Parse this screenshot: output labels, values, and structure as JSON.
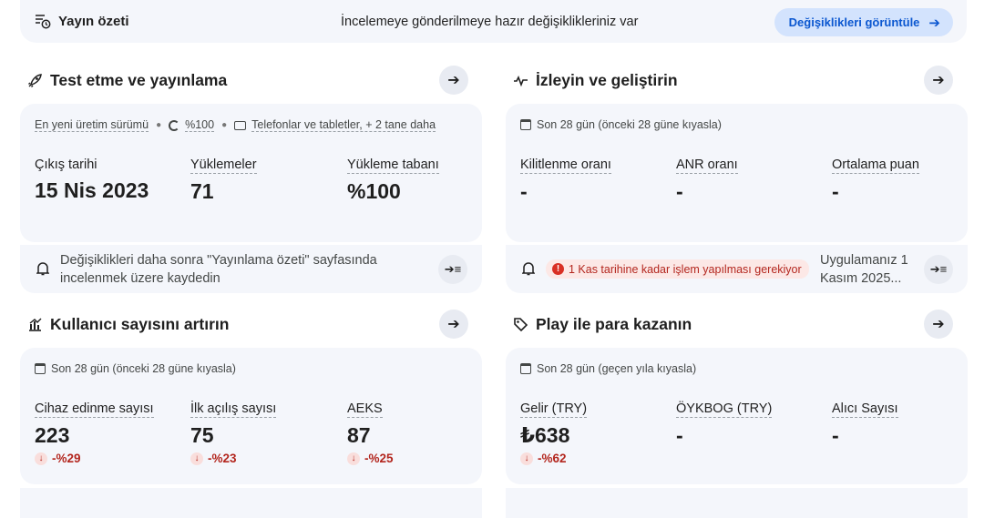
{
  "banner": {
    "title": "Yayın özeti",
    "message": "İncelemeye gönderilmeye hazır değişiklikleriniz var",
    "button": "Değişiklikleri görüntüle"
  },
  "sections": {
    "test": {
      "title": "Test etme ve yayınlama",
      "meta": {
        "release": "En yeni üretim sürümü",
        "rollout": "%100",
        "devices": "Telefonlar ve tabletler, + 2 tane daha"
      },
      "metrics": [
        {
          "label": "Çıkış tarihi",
          "value": "15 Nis 2023"
        },
        {
          "label": "Yüklemeler",
          "value": "71"
        },
        {
          "label": "Yükleme tabanı",
          "value": "%100"
        }
      ],
      "footer": "Değişiklikleri daha sonra \"Yayınlama özeti\" sayfasında incelenmek üzere kaydedin"
    },
    "monitor": {
      "title": "İzleyin ve geliştirin",
      "meta": "Son 28 gün (önceki 28 güne kıyasla)",
      "metrics": [
        {
          "label": "Kilitlenme oranı",
          "value": "-"
        },
        {
          "label": "ANR oranı",
          "value": "-"
        },
        {
          "label": "Ortalama puan",
          "value": "-"
        }
      ],
      "warning": "1 Kas tarihine kadar işlem yapılması gerekiyor",
      "footer": "Uygulamanız 1 Kasım 2025..."
    },
    "grow": {
      "title": "Kullanıcı sayısını artırın",
      "meta": "Son 28 gün (önceki 28 güne kıyasla)",
      "metrics": [
        {
          "label": "Cihaz edinme sayısı",
          "value": "223",
          "delta": "-%29"
        },
        {
          "label": "İlk açılış sayısı",
          "value": "75",
          "delta": "-%23"
        },
        {
          "label": "AEKS",
          "value": "87",
          "delta": "-%25"
        }
      ]
    },
    "monetize": {
      "title": "Play ile para kazanın",
      "meta": "Son 28 gün (geçen yıla kıyasla)",
      "metrics": [
        {
          "label": "Gelir (TRY)",
          "value": "₺638",
          "delta": "-%62"
        },
        {
          "label": "ÖYKBOG (TRY)",
          "value": "-"
        },
        {
          "label": "Alıcı Sayısı",
          "value": "-"
        }
      ]
    }
  },
  "colors": {
    "card_bg": "#f4f6fb",
    "accent": "#0b57d0",
    "negative": "#b3261e"
  }
}
